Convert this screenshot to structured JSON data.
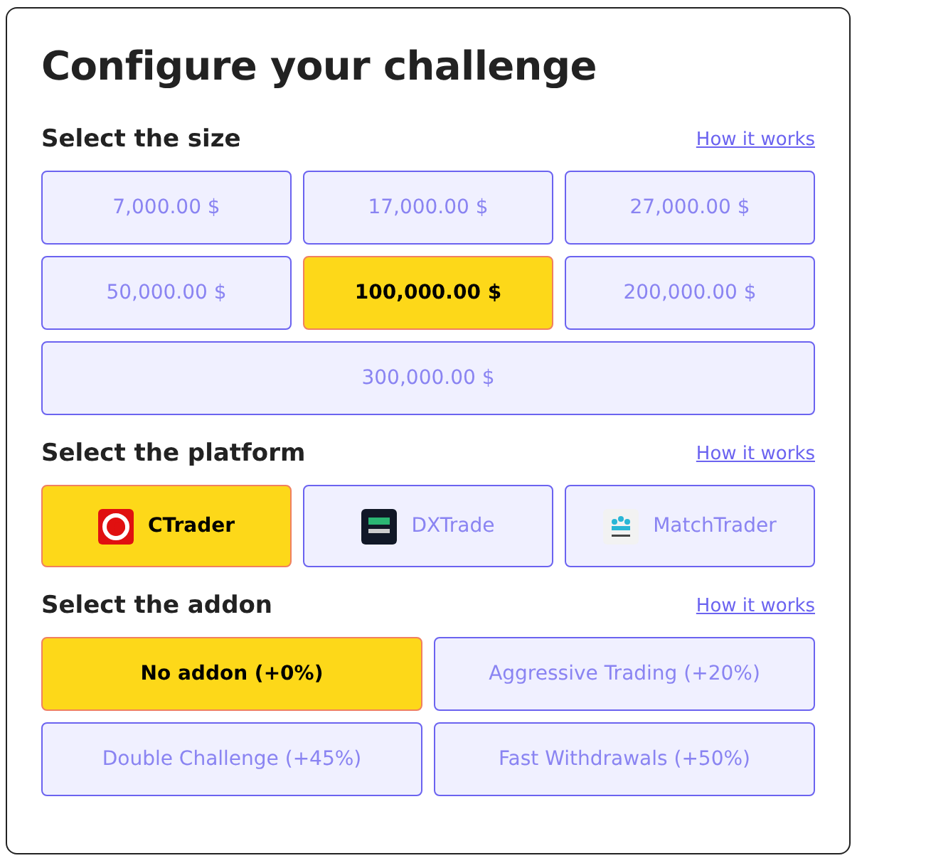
{
  "title": "Configure your challenge",
  "sections": [
    {
      "heading": "Select the size",
      "link": "How it works",
      "kind": "size",
      "options": [
        {
          "label": "7,000.00 $",
          "selected": false
        },
        {
          "label": "17,000.00 $",
          "selected": false
        },
        {
          "label": "27,000.00 $",
          "selected": false
        },
        {
          "label": "50,000.00 $",
          "selected": false
        },
        {
          "label": "100,000.00 $",
          "selected": true
        },
        {
          "label": "200,000.00 $",
          "selected": false
        },
        {
          "label": "300,000.00 $",
          "selected": false
        }
      ]
    },
    {
      "heading": "Select the platform",
      "link": "How it works",
      "kind": "platform",
      "options": [
        {
          "label": "CTrader",
          "selected": true,
          "kind": "spiral"
        },
        {
          "label": "DXTrade",
          "selected": false,
          "kind": "dark"
        },
        {
          "label": "MatchTrader",
          "selected": false,
          "kind": "bars"
        }
      ]
    },
    {
      "heading": "Select the addon",
      "link": "How it works",
      "kind": "addon",
      "options": [
        {
          "label": "No addon (+0%)",
          "selected": true
        },
        {
          "label": "Aggressive Trading (+20%)",
          "selected": false
        },
        {
          "label": "Double Challenge (+45%)",
          "selected": false
        },
        {
          "label": "Fast Withdrawals (+50%)",
          "selected": false
        }
      ]
    }
  ]
}
